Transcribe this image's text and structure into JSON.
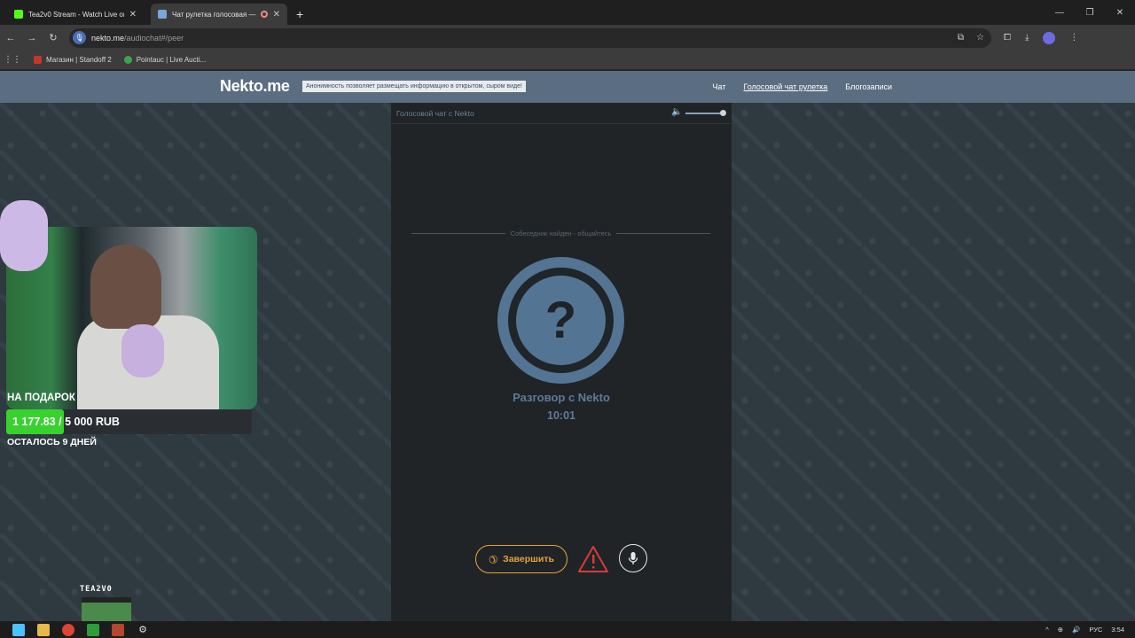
{
  "browser": {
    "tabs": [
      {
        "title": "Tea2v0 Stream - Watch Live on",
        "active": false
      },
      {
        "title": "Чат рулетка голосовая — ",
        "active": true
      }
    ],
    "url_host": "nekto.me",
    "url_path": "/audiochat#/peer",
    "bookmarks": [
      {
        "label": "Магазин | Standoff 2"
      },
      {
        "label": "Pointauc | Live Aucti..."
      }
    ]
  },
  "site": {
    "logo": "Nekto.me",
    "tagline": "Анонимность позволяет размещать информацию в открытом, сыром виде!",
    "nav": [
      {
        "label": "Чат",
        "current": false
      },
      {
        "label": "Голосовой чат рулетка",
        "current": true
      },
      {
        "label": "Блогозаписи",
        "current": false
      }
    ]
  },
  "panel": {
    "title": "Голосовой чат с Nekto",
    "status": "Собеседник найден - общайтесь",
    "avatar_symbol": "?",
    "conversation_title": "Разговор с Nekto",
    "timer": "10:01",
    "end_button": "Завершить"
  },
  "stream": {
    "gift_label": "НА ПОДАРОК",
    "gift_current": "1 177.83",
    "gift_rest": " / 5 000 RUB",
    "gift_progress_percent": 23.5,
    "days_left": "ОСТАЛОСЬ 9 ДНЕЙ",
    "channel_name": "TEA2V0"
  },
  "taskbar": {
    "lang": "РУС",
    "time": "3:54"
  },
  "colors": {
    "header": "#5b6d81",
    "panel": "#202427",
    "accent_orange": "#e6a33c",
    "avatar_blue": "#547493",
    "progress_green": "#39d12e"
  }
}
